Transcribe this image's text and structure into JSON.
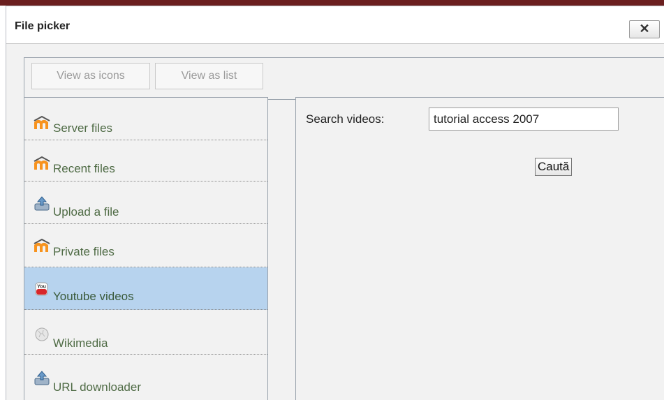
{
  "dialog": {
    "title": "File picker",
    "close_icon": "✕"
  },
  "toolbar": {
    "view_icons_label": "View as icons",
    "view_list_label": "View as list"
  },
  "sidebar": {
    "items": [
      {
        "label": "Server files",
        "icon": "moodle-icon"
      },
      {
        "label": "Recent files",
        "icon": "moodle-icon"
      },
      {
        "label": "Upload a file",
        "icon": "upload-icon"
      },
      {
        "label": "Private files",
        "icon": "moodle-icon"
      },
      {
        "label": "Youtube videos",
        "icon": "youtube-icon",
        "active": true
      },
      {
        "label": "Wikimedia",
        "icon": "wikimedia-icon"
      },
      {
        "label": "URL downloader",
        "icon": "upload-icon"
      }
    ]
  },
  "search": {
    "label": "Search videos:",
    "value": "tutorial access 2007",
    "button_label": "Caută"
  },
  "colors": {
    "active_item": "#b7d3ee",
    "item_text": "#4f6b45",
    "moodle_orange": "#f7931e",
    "youtube_red": "#d8262a"
  }
}
